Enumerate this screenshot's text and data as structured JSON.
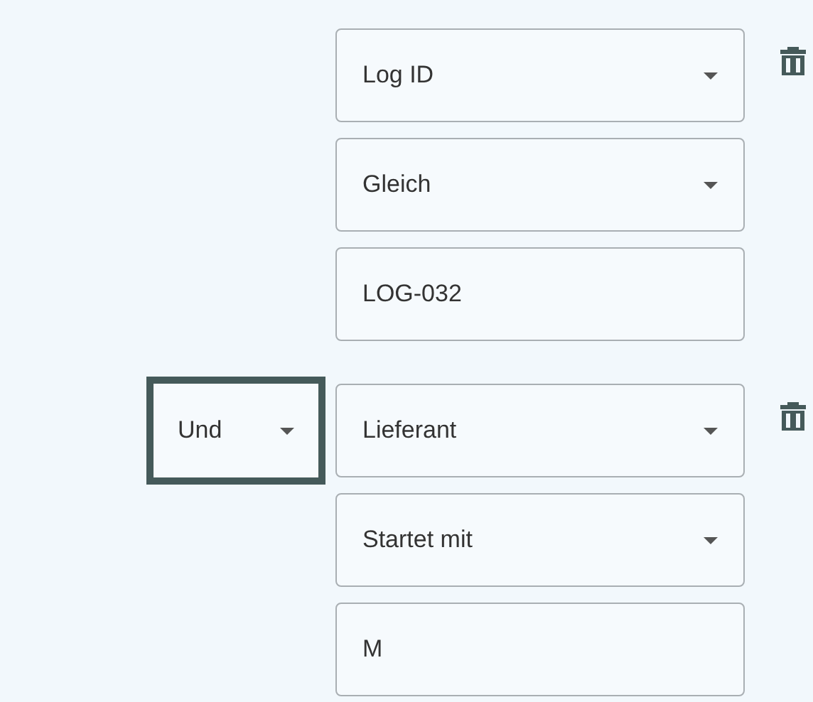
{
  "conditions": [
    {
      "fields": [
        {
          "kind": "select",
          "value": "Log ID"
        },
        {
          "kind": "select",
          "value": "Gleich"
        },
        {
          "kind": "text",
          "value": "LOG-032"
        }
      ]
    },
    {
      "conjunction": {
        "value": "Und",
        "focused": true
      },
      "fields": [
        {
          "kind": "select",
          "value": "Lieferant"
        },
        {
          "kind": "select",
          "value": "Startet mit"
        },
        {
          "kind": "text",
          "value": "M"
        }
      ]
    }
  ]
}
